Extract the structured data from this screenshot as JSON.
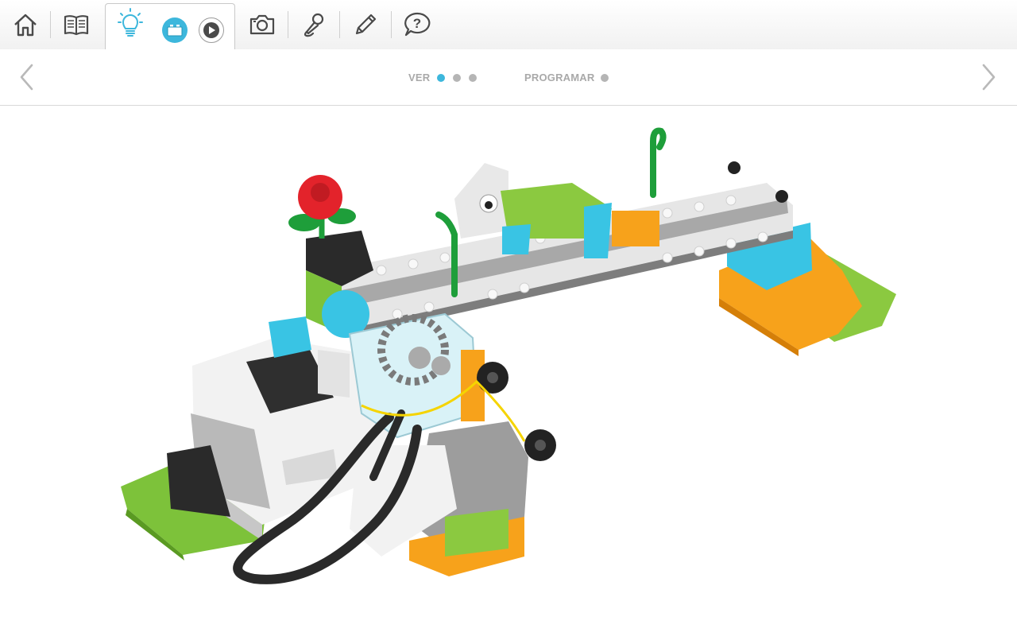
{
  "toolbar": {
    "items": [
      {
        "name": "home",
        "icon": "home-icon"
      },
      {
        "name": "book",
        "icon": "book-icon"
      },
      {
        "name": "idea",
        "icon": "lightbulb-icon",
        "active": true
      },
      {
        "name": "camera",
        "icon": "camera-icon"
      },
      {
        "name": "microphone",
        "icon": "microphone-icon"
      },
      {
        "name": "pencil",
        "icon": "pencil-icon"
      },
      {
        "name": "help",
        "icon": "help-bubble-icon"
      }
    ],
    "sub_items": [
      {
        "name": "build",
        "icon": "brick-icon",
        "active": true
      },
      {
        "name": "video",
        "icon": "play-icon"
      }
    ],
    "help_glyph": "?"
  },
  "steps": {
    "ver_label": "VER",
    "programar_label": "PROGRAMAR",
    "ver_current": 1,
    "ver_total": 3,
    "programar_total": 1
  },
  "colors": {
    "accent": "#3db7dc",
    "icon": "#4a4a4a",
    "inactive_dot": "#b5b5b5"
  },
  "model_image": {
    "icon": "lego-model-illustration"
  }
}
